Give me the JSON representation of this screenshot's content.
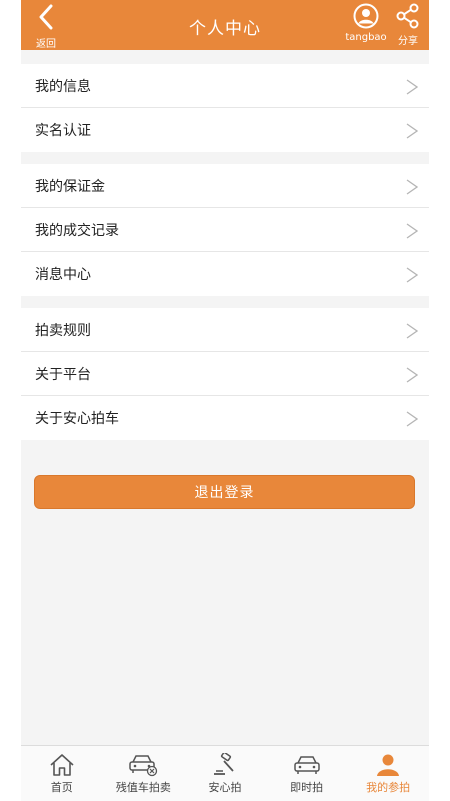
{
  "header": {
    "back_label": "返回",
    "title": "个人中心",
    "user_label": "tangbao",
    "share_label": "分享"
  },
  "menu": {
    "groups": [
      {
        "items": [
          {
            "label": "我的信息"
          },
          {
            "label": "实名认证"
          }
        ]
      },
      {
        "items": [
          {
            "label": "我的保证金"
          },
          {
            "label": "我的成交记录"
          },
          {
            "label": "消息中心"
          }
        ]
      },
      {
        "items": [
          {
            "label": "拍卖规则"
          },
          {
            "label": "关于平台"
          },
          {
            "label": "关于安心拍车"
          }
        ]
      }
    ]
  },
  "logout_label": "退出登录",
  "tabbar": {
    "items": [
      {
        "label": "首页",
        "icon": "home-icon"
      },
      {
        "label": "残值车拍卖",
        "icon": "damaged-car-icon"
      },
      {
        "label": "安心拍",
        "icon": "gavel-icon"
      },
      {
        "label": "即时拍",
        "icon": "car-icon"
      },
      {
        "label": "我的参拍",
        "icon": "person-icon",
        "active": true
      }
    ]
  },
  "colors": {
    "accent": "#e8873a",
    "background": "#f4f4f4"
  }
}
